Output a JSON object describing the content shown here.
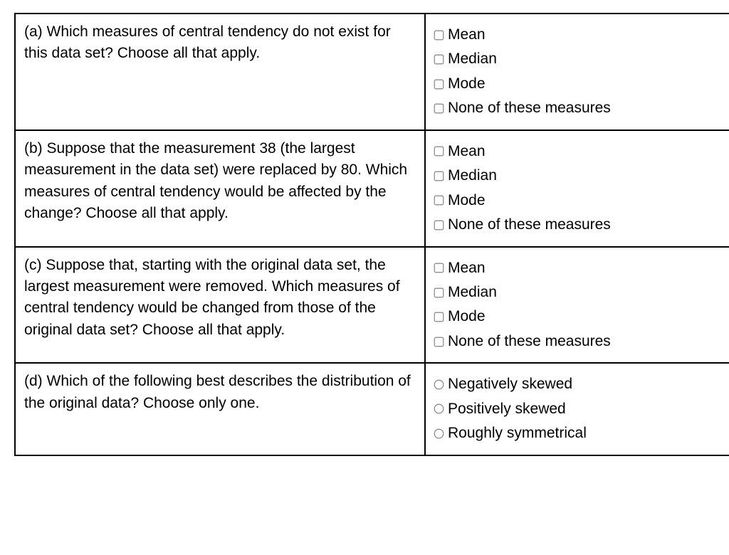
{
  "rows": [
    {
      "id": "a",
      "prompt": "(a) Which measures of central tendency do not exist for this data set? Choose all that apply.",
      "type": "checkbox",
      "options": [
        "Mean",
        "Median",
        "Mode",
        "None of these measures"
      ]
    },
    {
      "id": "b",
      "prompt": "(b) Suppose that the measurement 38 (the largest measurement in the data set) were replaced by 80. Which measures of central tendency would be affected by the change? Choose all that apply.",
      "type": "checkbox",
      "options": [
        "Mean",
        "Median",
        "Mode",
        "None of these measures"
      ]
    },
    {
      "id": "c",
      "prompt": "(c) Suppose that, starting with the original data set, the largest measurement were removed. Which measures of central tendency would be changed from those of the original data set? Choose all that apply.",
      "type": "checkbox",
      "options": [
        "Mean",
        "Median",
        "Mode",
        "None of these measures"
      ]
    },
    {
      "id": "d",
      "prompt": "(d) Which of the following best describes the distribution of the original data? Choose only one.",
      "type": "radio",
      "options": [
        "Negatively skewed",
        "Positively skewed",
        "Roughly symmetrical"
      ]
    }
  ]
}
